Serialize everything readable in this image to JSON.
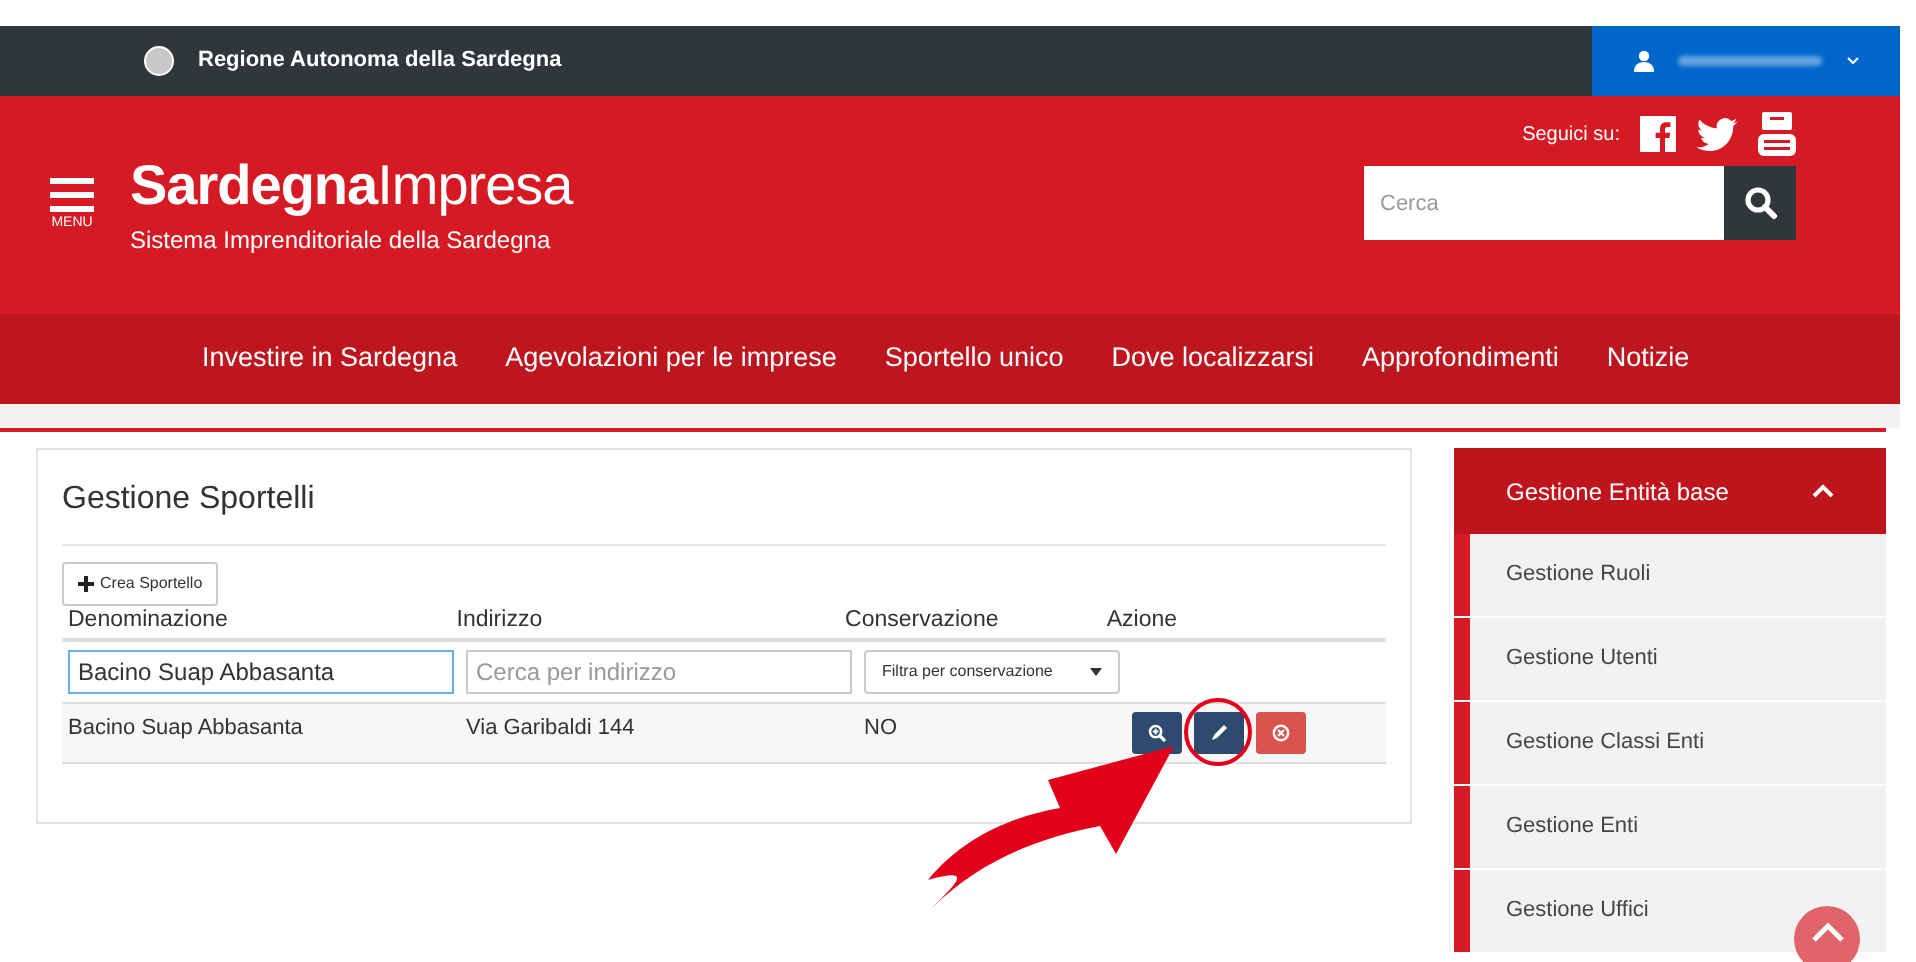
{
  "top_bar": {
    "region_name": "Regione Autonoma della Sardegna"
  },
  "header": {
    "menu_label": "MENU",
    "logo_bold": "Sardegna",
    "logo_light": "Impresa",
    "subtitle": "Sistema Imprenditoriale della Sardegna",
    "social_label": "Seguici su:",
    "search": {
      "placeholder": "Cerca"
    }
  },
  "nav": [
    "Investire in Sardegna",
    "Agevolazioni per le imprese",
    "Sportello unico",
    "Dove localizzarsi",
    "Approfondimenti",
    "Notizie"
  ],
  "panel": {
    "title": "Gestione Sportelli",
    "create_button": "Crea Sportello",
    "columns": [
      "Denominazione",
      "Indirizzo",
      "Conservazione",
      "Azione"
    ],
    "filters": [
      {
        "kind": "input",
        "value": "Bacino Suap Abbasanta"
      },
      {
        "kind": "input",
        "placeholder": "Cerca per indirizzo"
      },
      {
        "kind": "select",
        "value": "Filtra per conservazione"
      }
    ],
    "rows": [
      {
        "cells": [
          "Bacino Suap Abbasanta",
          "Via Garibaldi 144",
          "NO"
        ],
        "actions": [
          {
            "kind": "view",
            "highlighted": false
          },
          {
            "kind": "edit",
            "highlighted": true
          },
          {
            "kind": "delete",
            "highlighted": false
          }
        ]
      }
    ]
  },
  "sidebar": {
    "section": {
      "label": "Gestione Entità base",
      "expanded": true
    },
    "items": [
      "Gestione Ruoli",
      "Gestione Utenti",
      "Gestione Classi Enti",
      "Gestione Enti",
      "Gestione Uffici"
    ]
  }
}
